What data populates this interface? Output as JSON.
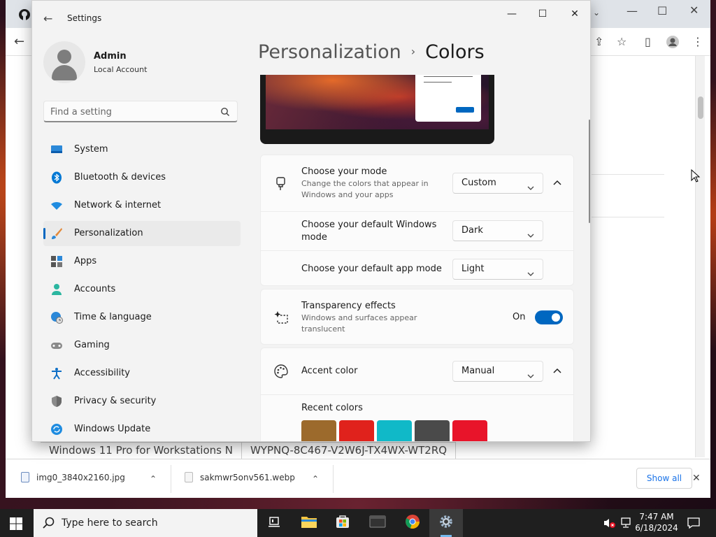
{
  "settings": {
    "title": "Settings",
    "user": {
      "name": "Admin",
      "account_type": "Local Account"
    },
    "search": {
      "placeholder": "Find a setting"
    },
    "nav": [
      {
        "label": "System",
        "icon": "monitor-icon"
      },
      {
        "label": "Bluetooth & devices",
        "icon": "bluetooth-icon"
      },
      {
        "label": "Network & internet",
        "icon": "wifi-icon"
      },
      {
        "label": "Personalization",
        "icon": "brush-icon",
        "active": true
      },
      {
        "label": "Apps",
        "icon": "apps-icon"
      },
      {
        "label": "Accounts",
        "icon": "person-icon"
      },
      {
        "label": "Time & language",
        "icon": "globe-clock-icon"
      },
      {
        "label": "Gaming",
        "icon": "gamepad-icon"
      },
      {
        "label": "Accessibility",
        "icon": "accessibility-icon"
      },
      {
        "label": "Privacy & security",
        "icon": "shield-icon"
      },
      {
        "label": "Windows Update",
        "icon": "update-icon"
      }
    ],
    "breadcrumb": {
      "parent": "Personalization",
      "separator": "›",
      "current": "Colors"
    },
    "mode": {
      "title": "Choose your mode",
      "description": "Change the colors that appear in Windows and your apps",
      "value": "Custom",
      "windows_mode_label": "Choose your default Windows mode",
      "windows_mode_value": "Dark",
      "app_mode_label": "Choose your default app mode",
      "app_mode_value": "Light"
    },
    "transparency": {
      "title": "Transparency effects",
      "description": "Windows and surfaces appear translucent",
      "state_label": "On",
      "on": true
    },
    "accent": {
      "title": "Accent color",
      "value": "Manual",
      "recent_label": "Recent colors",
      "recent_colors": [
        "#9c6a2c",
        "#e0221c",
        "#10b9c8",
        "#4a4a4a",
        "#e8142a"
      ]
    }
  },
  "browser": {
    "table_cells": [
      "Windows 11 Pro for Workstations N",
      "WYPNQ-8C467-V2W6J-TX4WX-WT2RQ"
    ],
    "downloads": [
      {
        "name": "img0_3840x2160.jpg"
      },
      {
        "name": "sakmwr5onv561.webp"
      }
    ],
    "show_all_label": "Show all"
  },
  "taskbar": {
    "search_placeholder": "Type here to search",
    "time": "7:47 AM",
    "date": "6/18/2024"
  },
  "colors": {
    "accent": "#0067c0"
  }
}
